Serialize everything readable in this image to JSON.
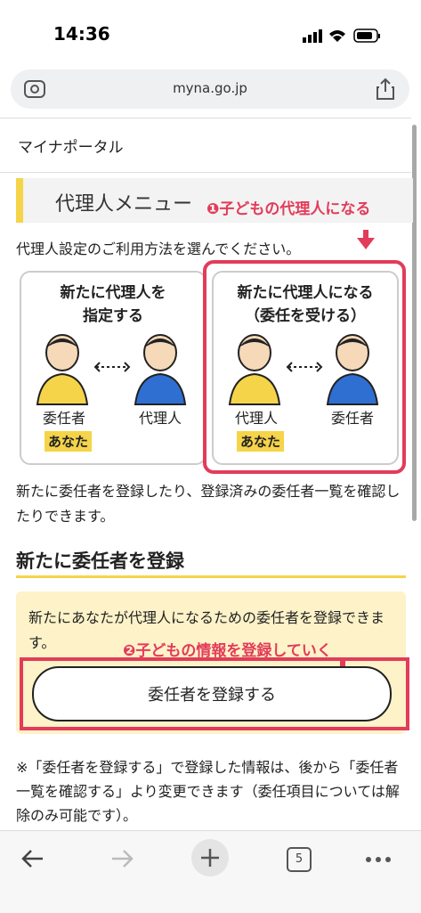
{
  "status": {
    "time": "14:36"
  },
  "browser": {
    "url": "myna.go.jp",
    "tab_count": "5"
  },
  "site": {
    "title": "マイナポータル"
  },
  "menu": {
    "title": "代理人メニュー",
    "annotation1": "❶子どもの代理人になる",
    "intro": "代理人設定のご利用方法を選んでください。"
  },
  "cards": {
    "left": {
      "title_line1": "新たに代理人を",
      "title_line2": "指定する",
      "role_left": "委任者",
      "role_right": "代理人",
      "you": "あなた"
    },
    "right": {
      "title_line1": "新たに代理人になる",
      "title_line2": "（委任を受ける）",
      "role_left": "代理人",
      "role_right": "委任者",
      "you": "あなた"
    }
  },
  "description": "新たに委任者を登録したり、登録済みの委任者一覧を確認したりできます。",
  "section": {
    "title": "新たに委任者を登録",
    "box_text": "新たにあなたが代理人になるための委任者を登録できます。",
    "annotation2": "❷子どもの情報を登録していく",
    "button_label": "委任者を登録する",
    "note": "※「委任者を登録する」で登録した情報は、後から「委任者一覧を確認する」より変更できます（委任項目については解除のみ可能です）。"
  },
  "colors": {
    "accent": "#e23c5a",
    "yellow": "#f5d44a",
    "blue": "#2f6fd1",
    "light_yellow": "#fdf2c8"
  },
  "icons": [
    "back-icon",
    "forward-icon",
    "new-tab-icon",
    "tabs-icon",
    "more-icon",
    "camera-icon",
    "share-icon"
  ]
}
